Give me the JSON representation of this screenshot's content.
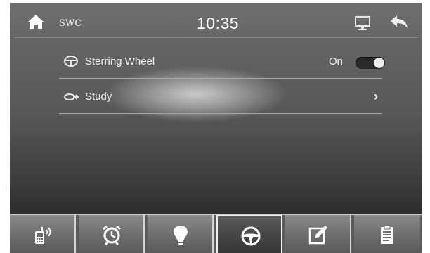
{
  "status_bar": {
    "title": "SWC",
    "time": "10:35",
    "home_icon": "home-icon",
    "display_icon": "monitor-icon",
    "back_icon": "back-arrow-icon"
  },
  "menu": {
    "steering_wheel": {
      "label": "Sterring Wheel",
      "state": "On",
      "icon": "steering-wheel-icon"
    },
    "study": {
      "label": "Study",
      "icon": "learn-icon",
      "chevron": "›"
    }
  },
  "dock": {
    "items": [
      {
        "name": "phone",
        "icon": "bluetooth-phone-icon"
      },
      {
        "name": "alarm",
        "icon": "alarm-clock-icon"
      },
      {
        "name": "light",
        "icon": "light-bulb-icon"
      },
      {
        "name": "steering",
        "icon": "steering-wheel-icon",
        "active": true
      },
      {
        "name": "edit",
        "icon": "edit-note-icon"
      },
      {
        "name": "clipboard",
        "icon": "clipboard-icon"
      }
    ]
  }
}
